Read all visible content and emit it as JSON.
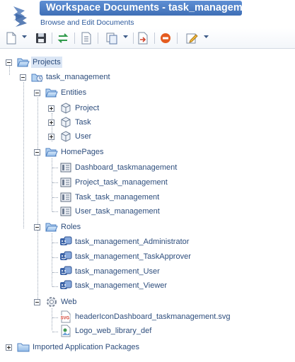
{
  "header": {
    "title": "Workspace Documents - task_management",
    "subtitle": "Browse and Edit Documents"
  },
  "toolbar": {
    "buttons": [
      "new-document-icon",
      "save-icon",
      "swap-icon",
      "document-icon",
      "copy-icon",
      "export-icon",
      "delete-icon",
      "edit-icon"
    ]
  },
  "tree": {
    "projects": "Projects",
    "project_name": "task_management",
    "entities": {
      "label": "Entities",
      "items": [
        "Project",
        "Task",
        "User"
      ]
    },
    "homepages": {
      "label": "HomePages",
      "items": [
        "Dashboard_taskmanagement",
        "Project_task_management",
        "Task_task_management",
        "User_task_management"
      ]
    },
    "roles": {
      "label": "Roles",
      "items": [
        "task_management_Administrator",
        "task_management_TaskApprover",
        "task_management_User",
        "task_management_Viewer"
      ]
    },
    "web": {
      "label": "Web",
      "items": [
        "headerIconDashboard_taskmanagement.svg",
        "Logo_web_library_def"
      ]
    },
    "imported": "Imported Application Packages"
  },
  "colors": {
    "title_bar": "#4a7cc4",
    "link_text": "#2d4d7c",
    "selection": "#dbe6f5"
  }
}
